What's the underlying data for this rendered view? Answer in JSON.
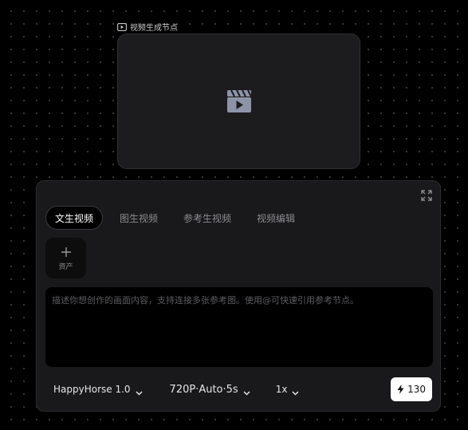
{
  "node": {
    "label": "视频生成节点",
    "icon": "video-play-icon",
    "preview_icon": "clapperboard-play-icon"
  },
  "panel": {
    "expand_icon": "expand-icon",
    "tabs": [
      {
        "label": "文生视频",
        "active": true
      },
      {
        "label": "图生视频",
        "active": false
      },
      {
        "label": "参考生视频",
        "active": false
      },
      {
        "label": "视频编辑",
        "active": false
      }
    ],
    "asset_button": {
      "icon": "plus-icon",
      "label": "资产"
    },
    "prompt": {
      "value": "",
      "placeholder": "描述你想创作的画面内容，支持连接多张参考图。使用@可快速引用参考节点。"
    },
    "controls": {
      "model": "HappyHorse 1.0",
      "settings": "720P·Auto·5s",
      "count": "1x"
    },
    "credits": {
      "icon": "lightning-icon",
      "value": "130"
    }
  },
  "colors": {
    "background": "#000000",
    "card": "#1c1c1e",
    "panel": "#19191b",
    "accent_button": "#ffffff"
  }
}
